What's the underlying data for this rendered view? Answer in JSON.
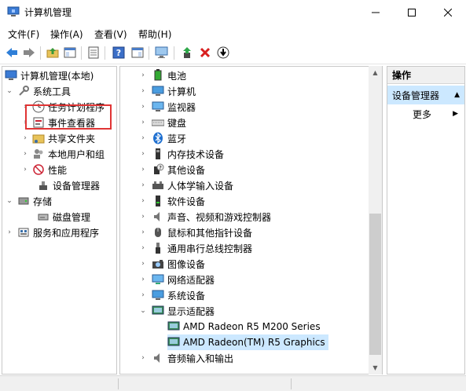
{
  "window": {
    "title": "计算机管理"
  },
  "menu": [
    "文件(F)",
    "操作(A)",
    "查看(V)",
    "帮助(H)"
  ],
  "left_tree": [
    {
      "label": "计算机管理(本地)",
      "indent": 0,
      "arrow": "",
      "icon": "computer-management-icon"
    },
    {
      "label": "系统工具",
      "indent": 1,
      "arrow": "expanded",
      "icon": "tools-icon"
    },
    {
      "label": "任务计划程序",
      "indent": 2,
      "arrow": "collapsed",
      "icon": "clock-icon"
    },
    {
      "label": "事件查看器",
      "indent": 2,
      "arrow": "collapsed",
      "icon": "event-viewer-icon"
    },
    {
      "label": "共享文件夹",
      "indent": 2,
      "arrow": "collapsed",
      "icon": "shared-folder-icon"
    },
    {
      "label": "本地用户和组",
      "indent": 2,
      "arrow": "collapsed",
      "icon": "users-icon"
    },
    {
      "label": "性能",
      "indent": 2,
      "arrow": "collapsed",
      "icon": "performance-icon"
    },
    {
      "label": "设备管理器",
      "indent": 2,
      "arrow": "",
      "icon": "device-manager-icon"
    },
    {
      "label": "存储",
      "indent": 1,
      "arrow": "expanded",
      "icon": "storage-icon"
    },
    {
      "label": "磁盘管理",
      "indent": 2,
      "arrow": "",
      "icon": "disk-icon"
    },
    {
      "label": "服务和应用程序",
      "indent": 1,
      "arrow": "collapsed",
      "icon": "services-icon"
    }
  ],
  "device_tree": [
    {
      "label": "电池",
      "arrow": "collapsed",
      "indent": 0,
      "icon": "battery-icon"
    },
    {
      "label": "计算机",
      "arrow": "collapsed",
      "indent": 0,
      "icon": "computer-icon"
    },
    {
      "label": "监视器",
      "arrow": "collapsed",
      "indent": 0,
      "icon": "monitor-icon"
    },
    {
      "label": "键盘",
      "arrow": "collapsed",
      "indent": 0,
      "icon": "keyboard-icon"
    },
    {
      "label": "蓝牙",
      "arrow": "collapsed",
      "indent": 0,
      "icon": "bluetooth-icon"
    },
    {
      "label": "内存技术设备",
      "arrow": "collapsed",
      "indent": 0,
      "icon": "memory-icon"
    },
    {
      "label": "其他设备",
      "arrow": "collapsed",
      "indent": 0,
      "icon": "unknown-device-icon"
    },
    {
      "label": "人体学输入设备",
      "arrow": "collapsed",
      "indent": 0,
      "icon": "hid-icon"
    },
    {
      "label": "软件设备",
      "arrow": "collapsed",
      "indent": 0,
      "icon": "software-device-icon"
    },
    {
      "label": "声音、视频和游戏控制器",
      "arrow": "collapsed",
      "indent": 0,
      "icon": "speaker-icon"
    },
    {
      "label": "鼠标和其他指针设备",
      "arrow": "collapsed",
      "indent": 0,
      "icon": "mouse-icon"
    },
    {
      "label": "通用串行总线控制器",
      "arrow": "collapsed",
      "indent": 0,
      "icon": "usb-icon"
    },
    {
      "label": "图像设备",
      "arrow": "collapsed",
      "indent": 0,
      "icon": "camera-icon"
    },
    {
      "label": "网络适配器",
      "arrow": "collapsed",
      "indent": 0,
      "icon": "network-icon"
    },
    {
      "label": "系统设备",
      "arrow": "collapsed",
      "indent": 0,
      "icon": "system-device-icon"
    },
    {
      "label": "显示适配器",
      "arrow": "expanded",
      "indent": 0,
      "icon": "display-adapter-icon"
    },
    {
      "label": "AMD Radeon R5 M200 Series",
      "arrow": "",
      "indent": 1,
      "icon": "display-adapter-icon"
    },
    {
      "label": "AMD Radeon(TM) R5 Graphics",
      "arrow": "",
      "indent": 1,
      "icon": "display-adapter-icon",
      "selected": true
    },
    {
      "label": "音频输入和输出",
      "arrow": "collapsed",
      "indent": 0,
      "icon": "audio-io-icon"
    }
  ],
  "actions": {
    "header": "操作",
    "section": "设备管理器",
    "more": "更多"
  }
}
